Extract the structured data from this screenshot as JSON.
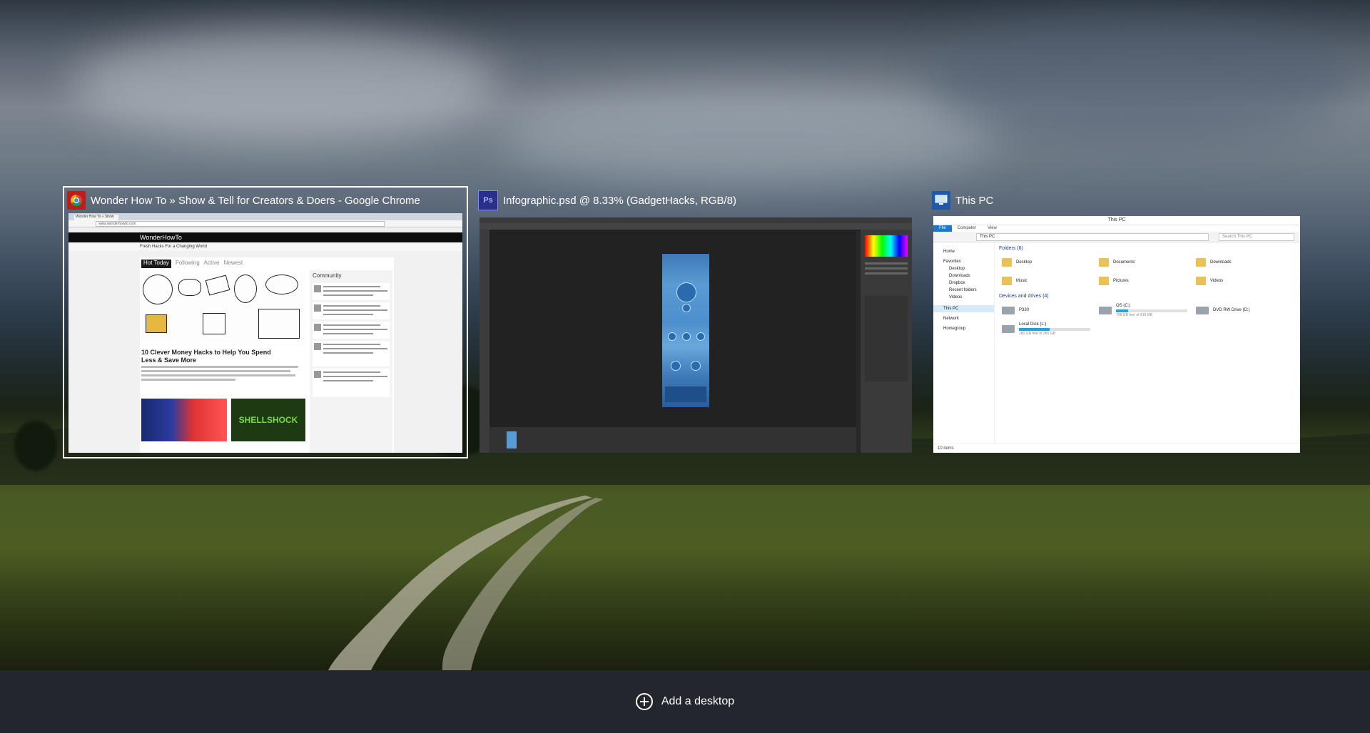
{
  "windows": [
    {
      "title": "Wonder How To » Show & Tell for Creators & Doers - Google Chrome",
      "app": "chrome",
      "selected": true,
      "content": {
        "tab_label": "Wonder How To » Show",
        "url": "www.wonderhowto.com",
        "site_name": "WonderHowTo",
        "tagline": "Fresh Hacks For a Changing World",
        "nav_tabs": [
          "Hot Today",
          "Following",
          "Active",
          "Newest"
        ],
        "headline": "10 Clever Money Hacks to Help You Spend Less & Save More",
        "banner_text": "SHELLSHOCK",
        "sidebar_title": "Community"
      }
    },
    {
      "title": "Infographic.psd @ 8.33% (GadgetHacks, RGB/8)",
      "app": "photoshop",
      "selected": false,
      "icon_text": "Ps"
    },
    {
      "title": "This PC",
      "app": "explorer",
      "selected": false,
      "content": {
        "window_title": "This PC",
        "ribbon": [
          "File",
          "Computer",
          "View"
        ],
        "address": "This PC",
        "search_placeholder": "Search This PC",
        "nav": [
          "Home",
          "Favorites",
          "Desktop",
          "Downloads",
          "Dropbox",
          "Recent folders",
          "Videos",
          "This PC",
          "Network",
          "Homegroup"
        ],
        "folders_header": "Folders (6)",
        "folders": [
          "Desktop",
          "Documents",
          "Downloads",
          "Music",
          "Pictures",
          "Videos"
        ],
        "drives_header": "Devices and drives (4)",
        "drives": [
          {
            "name": "P330",
            "free": ""
          },
          {
            "name": "OS (C:)",
            "free": "758 GB free of 910 GB",
            "used_fraction": 0.17
          },
          {
            "name": "DVD RW Drive (D:)",
            "free": ""
          },
          {
            "name": "Local Disk (L:)",
            "free": "180 GB free of 265 GB",
            "used_fraction": 0.43
          }
        ],
        "status": "10 items"
      }
    }
  ],
  "add_desktop_label": "Add a desktop",
  "colors": {
    "selection_border": "#ffffff",
    "bottom_bar": "#23272d",
    "photoshop_icon": "#2b2f8a",
    "explorer_accent": "#1979ca"
  }
}
